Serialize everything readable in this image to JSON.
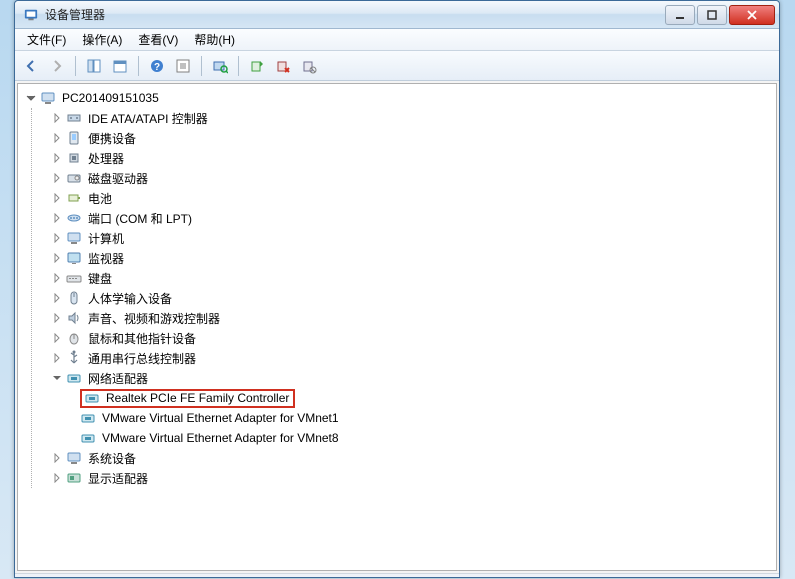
{
  "window": {
    "title": "设备管理器"
  },
  "menu": {
    "file": "文件(F)",
    "action": "操作(A)",
    "view": "查看(V)",
    "help": "帮助(H)"
  },
  "tree": {
    "root": "PC201409151035",
    "nodes": [
      "IDE ATA/ATAPI 控制器",
      "便携设备",
      "处理器",
      "磁盘驱动器",
      "电池",
      "端口 (COM 和 LPT)",
      "计算机",
      "监视器",
      "键盘",
      "人体学输入设备",
      "声音、视频和游戏控制器",
      "鼠标和其他指针设备",
      "通用串行总线控制器"
    ],
    "network_label": "网络适配器",
    "network_children": [
      "Realtek PCIe FE Family Controller",
      "VMware Virtual Ethernet Adapter for VMnet1",
      "VMware Virtual Ethernet Adapter for VMnet8"
    ],
    "tail_nodes": [
      "系统设备",
      "显示适配器"
    ]
  }
}
